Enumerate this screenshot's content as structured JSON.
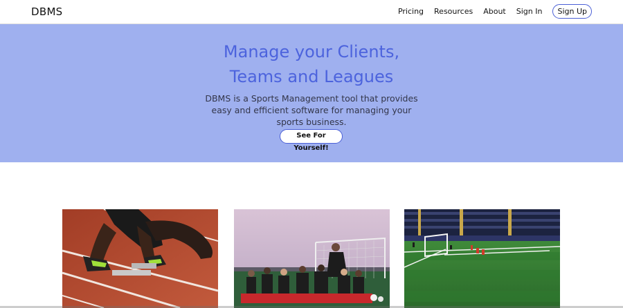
{
  "navbar": {
    "brand": "DBMS",
    "links": [
      "Pricing",
      "Resources",
      "About",
      "Sign In"
    ],
    "signup_label": "Sign Up"
  },
  "hero": {
    "title_line1": "Manage your Clients,",
    "title_line2": "Teams and Leagues",
    "desc_line1": "DBMS is a Sports Management tool that provides",
    "desc_line2": "easy and efficient software for managing your",
    "desc_line3": "sports business.",
    "cta_label": "See For Yourself!"
  },
  "cards": [
    {
      "image_alt": "Sprinter at starting blocks on red running track"
    },
    {
      "image_alt": "Youth soccer team huddled with coach in front of goal"
    },
    {
      "image_alt": "Professional soccer match in a stadium"
    }
  ],
  "colors": {
    "hero_bg": "#9fb0ef",
    "accent": "#4c63dd",
    "button_border": "#4a5fd6"
  }
}
